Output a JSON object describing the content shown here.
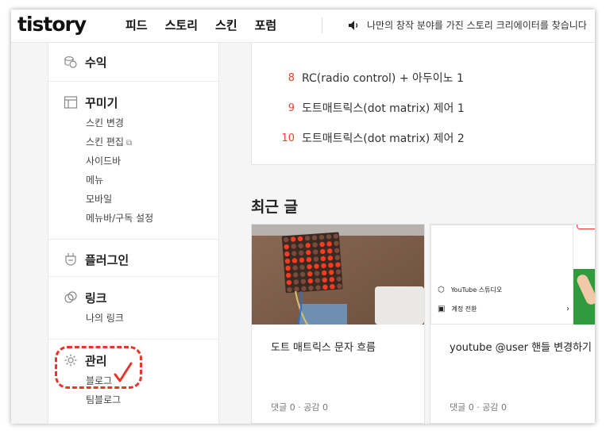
{
  "header": {
    "logo": "tistory",
    "nav": [
      "피드",
      "스토리",
      "스킨",
      "포럼"
    ],
    "notice": "나만의 창작 분야를 가진 스토리 크리에이터를 찾습니다"
  },
  "sidebar": {
    "sections": [
      {
        "title": "수익",
        "icon": "coin-stack-icon",
        "items": []
      },
      {
        "title": "꾸미기",
        "icon": "layout-icon",
        "items": [
          "스킨 변경",
          "스킨 편집",
          "사이드바",
          "메뉴",
          "모바일",
          "메뉴바/구독 설정"
        ]
      },
      {
        "title": "플러그인",
        "icon": "plug-icon",
        "items": []
      },
      {
        "title": "링크",
        "icon": "link-icon",
        "items": [
          "나의 링크"
        ]
      },
      {
        "title": "관리",
        "icon": "gear-icon",
        "items": [
          "블로그",
          "팀블로그"
        ]
      }
    ]
  },
  "popular": [
    {
      "rank": "8",
      "title": "RC(radio control) + 아두이노 1"
    },
    {
      "rank": "9",
      "title": "도트매트릭스(dot matrix) 제어 1"
    },
    {
      "rank": "10",
      "title": "도트매트릭스(dot matrix) 제어 2"
    }
  ],
  "recent": {
    "title": "최근 글",
    "posts": [
      {
        "title": "도트 매트릭스 문자 흐름",
        "meta": "댓글 0 · 공감 0"
      },
      {
        "title": "youtube @user 핸들 변경하기",
        "meta": "댓글 0 · 공감 0",
        "thumb": {
          "menu1": "YouTube 스튜디오",
          "menu2": "계정 전환"
        }
      }
    ]
  },
  "colors": {
    "accent": "#e8442c",
    "annotation": "#e8362a"
  }
}
